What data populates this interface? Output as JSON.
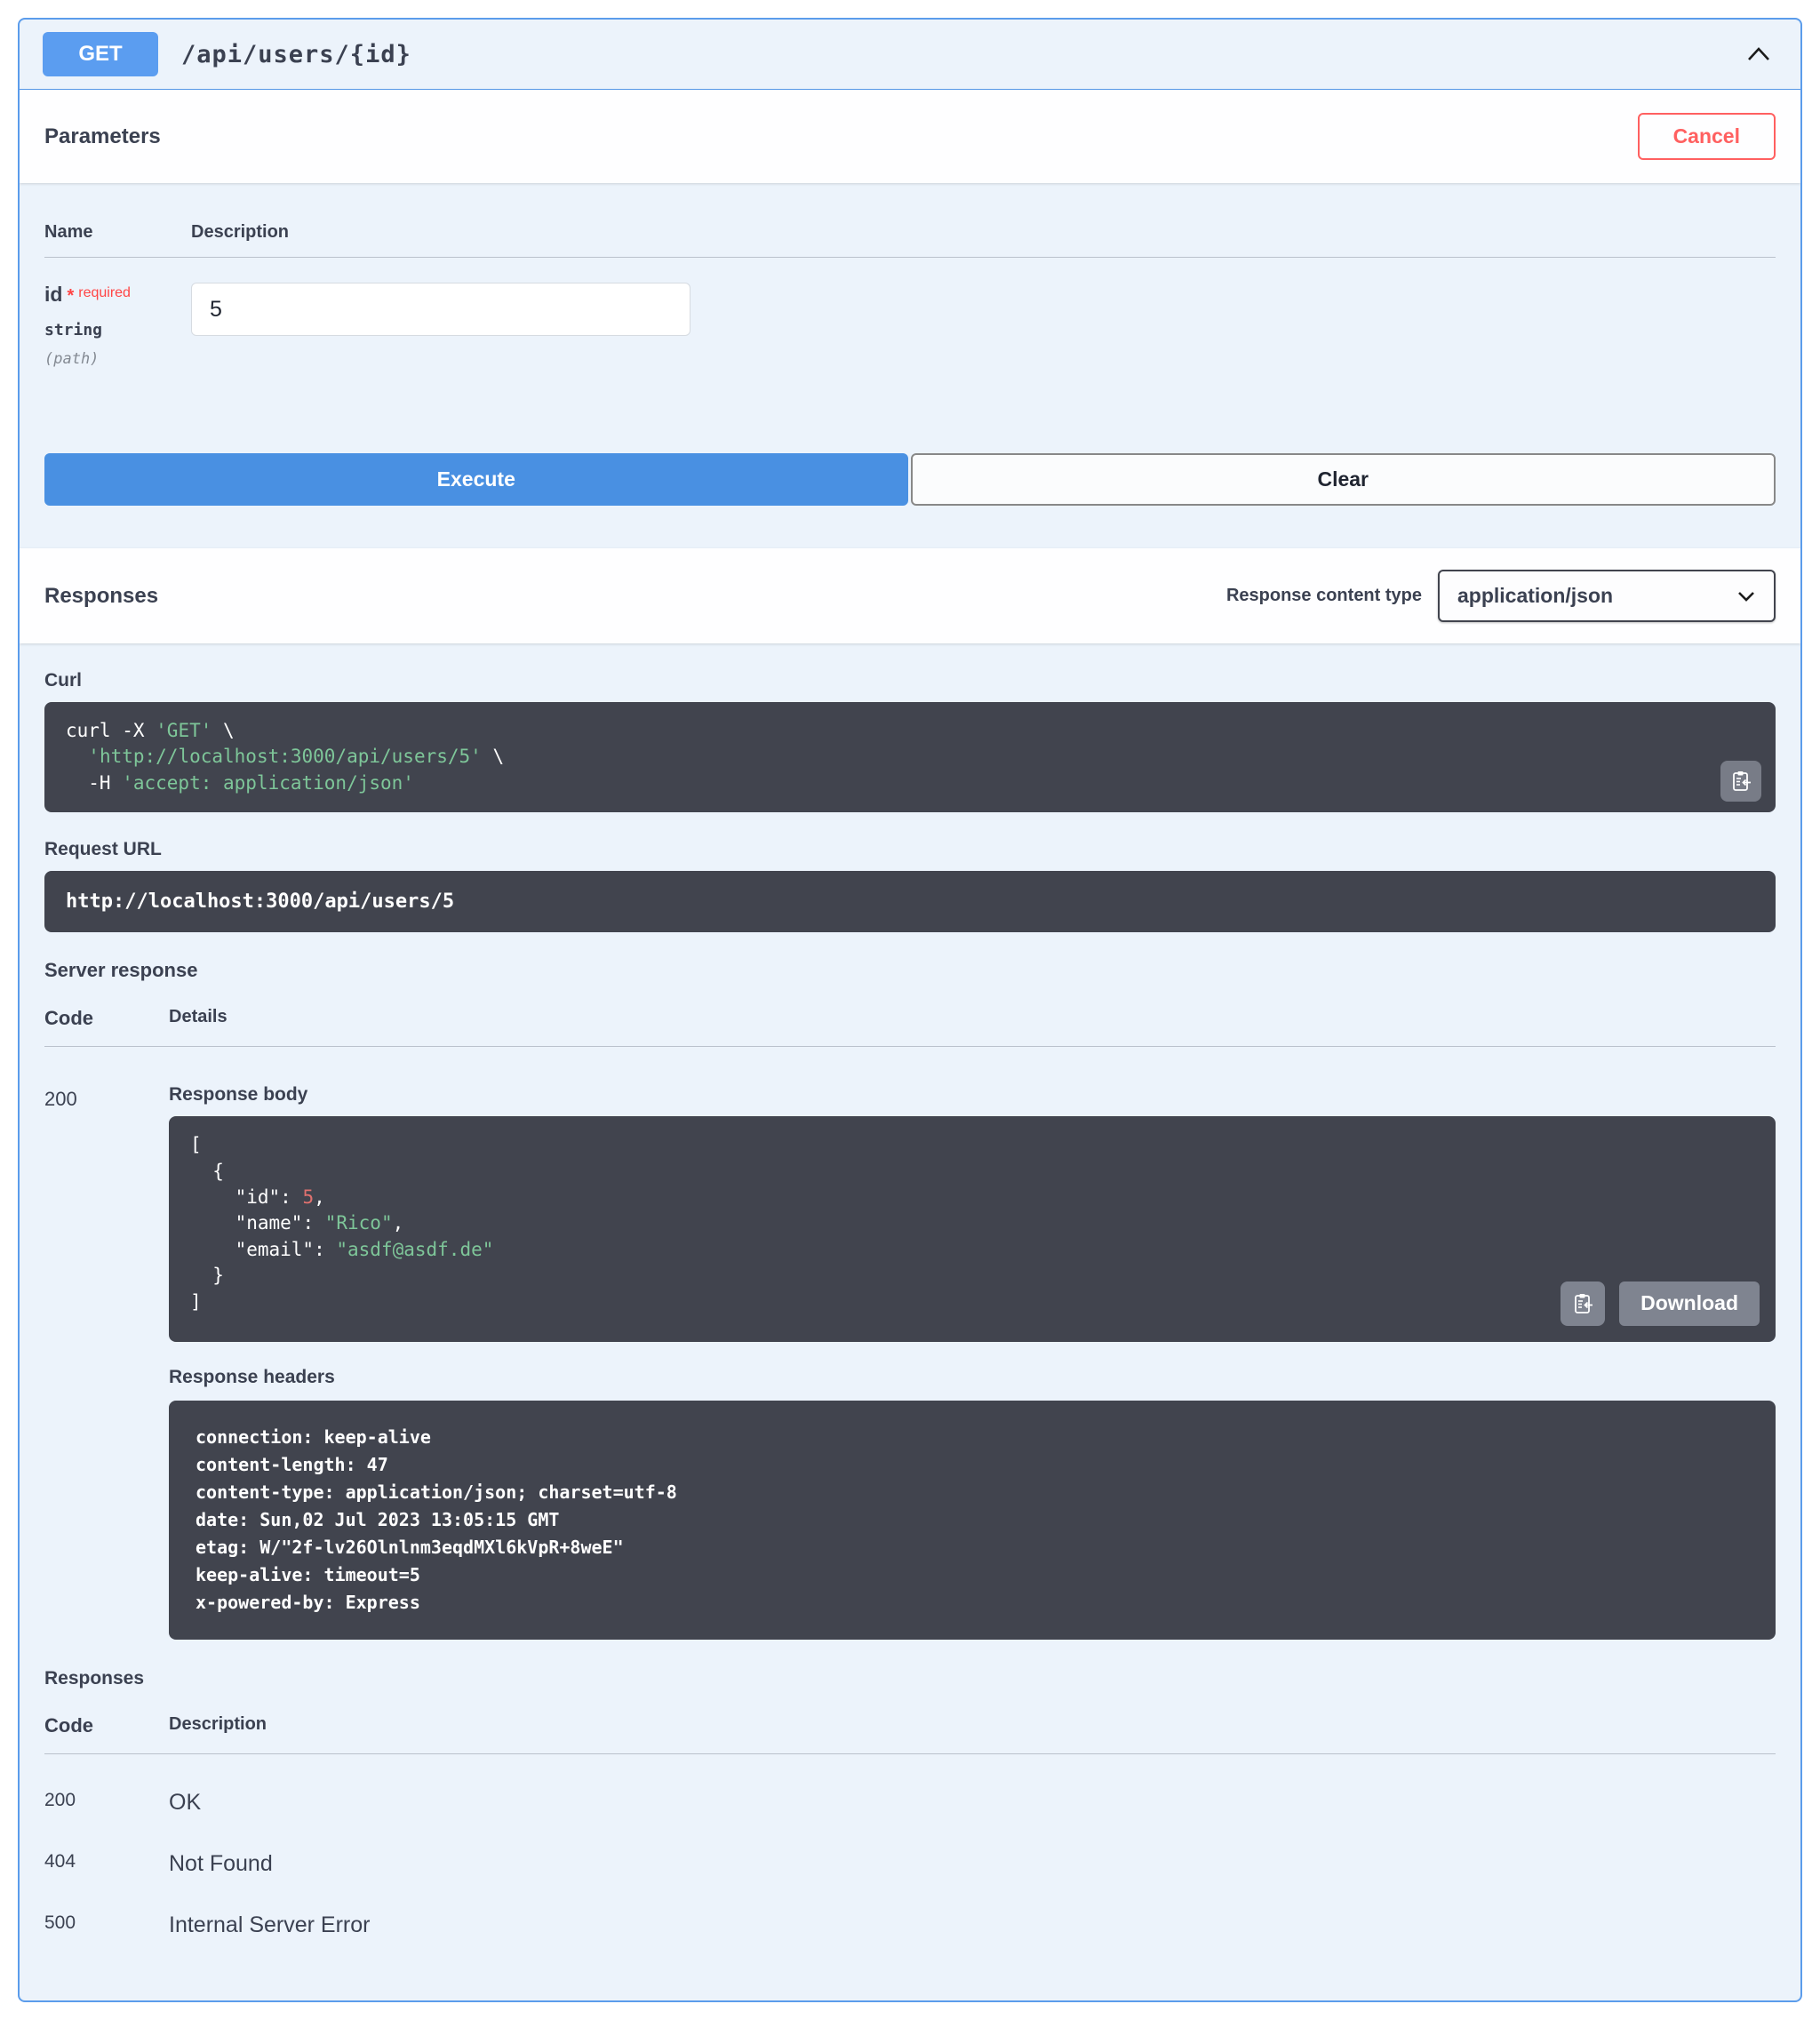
{
  "endpoint": {
    "method": "GET",
    "path": "/api/users/{id}"
  },
  "parameters_section": {
    "title": "Parameters",
    "cancel_label": "Cancel",
    "name_header": "Name",
    "description_header": "Description",
    "param": {
      "name": "id",
      "required_star": "*",
      "required_label": "required",
      "type": "string",
      "location": "(path)",
      "value": "5"
    },
    "execute_label": "Execute",
    "clear_label": "Clear"
  },
  "responses_section": {
    "title": "Responses",
    "content_type_label": "Response content type",
    "content_type_value": "application/json"
  },
  "request": {
    "curl_label": "Curl",
    "curl_lines": [
      {
        "pre": "curl -X ",
        "str": "'GET'",
        "post": " \\"
      },
      {
        "pre": "  ",
        "str": "'http://localhost:3000/api/users/5'",
        "post": " \\"
      },
      {
        "pre": "  -H ",
        "str": "'accept: application/json'",
        "post": ""
      }
    ],
    "request_url_label": "Request URL",
    "request_url": "http://localhost:3000/api/users/5"
  },
  "server_response": {
    "title": "Server response",
    "code_header": "Code",
    "details_header": "Details",
    "status_code": "200",
    "response_body_label": "Response body",
    "body": {
      "open_bracket": "[",
      "open_brace": "  {",
      "id_key": "    \"id\"",
      "id_sep": ": ",
      "id_value": "5",
      "id_tail": ",",
      "name_key": "    \"name\"",
      "name_sep": ": ",
      "name_value": "\"Rico\"",
      "name_tail": ",",
      "email_key": "    \"email\"",
      "email_sep": ": ",
      "email_value": "\"asdf@asdf.de\"",
      "close_brace": "  }",
      "close_bracket": "]"
    },
    "download_label": "Download",
    "response_headers_label": "Response headers",
    "headers": [
      "connection: keep-alive",
      "content-length: 47",
      "content-type: application/json; charset=utf-8",
      "date: Sun,02 Jul 2023 13:05:15 GMT",
      "etag: W/\"2f-lv26Olnlnm3eqdMXl6kVpR+8weE\"",
      "keep-alive: timeout=5",
      "x-powered-by: Express"
    ]
  },
  "responses_doc": {
    "title": "Responses",
    "code_header": "Code",
    "description_header": "Description",
    "rows": [
      {
        "code": "200",
        "description": "OK"
      },
      {
        "code": "404",
        "description": "Not Found"
      },
      {
        "code": "500",
        "description": "Internal Server Error"
      }
    ]
  },
  "colors": {
    "method_badge_blue": "#5b9df0",
    "panel_border_blue": "#5b9ceb",
    "panel_bg_blue": "#ecf3fb",
    "execute_blue": "#4990e2",
    "cancel_red": "#ff6060",
    "code_block_dark": "#41444e",
    "code_string_green": "#7ec699",
    "code_number_red": "#e0716f",
    "gray_button": "#7f8490"
  }
}
